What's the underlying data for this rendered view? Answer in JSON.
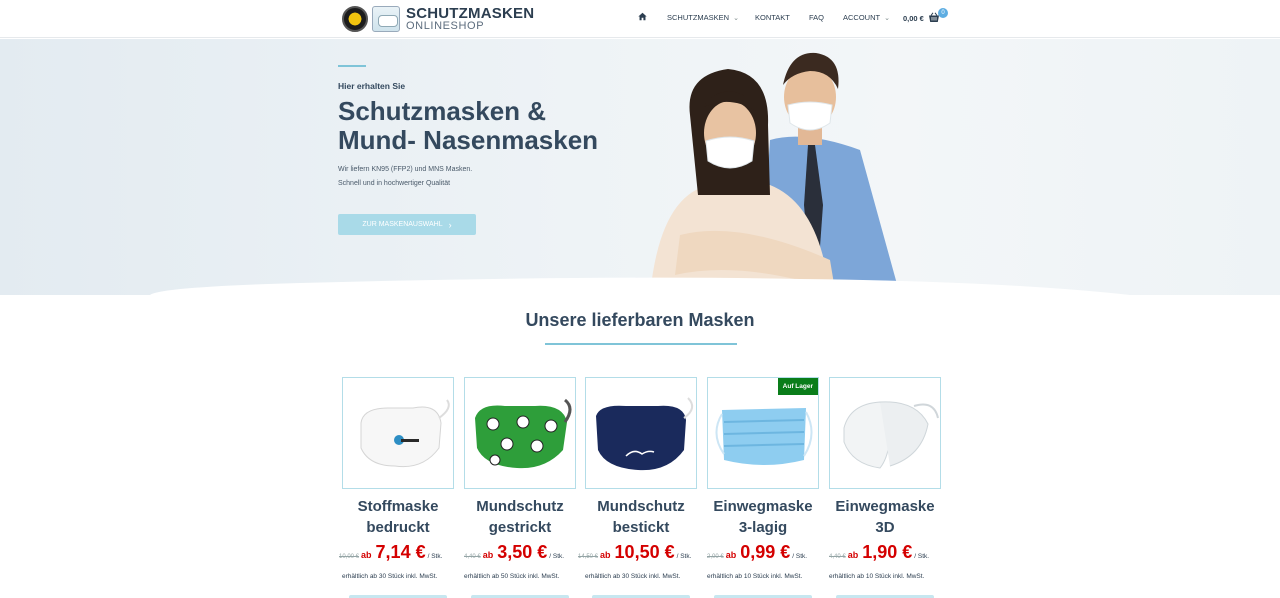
{
  "header": {
    "logo_title": "SCHUTZMASKEN",
    "logo_subtitle": "ONLINESHOP",
    "nav": [
      {
        "label": "SCHUTZMASKEN",
        "caret": true
      },
      {
        "label": "KONTAKT",
        "caret": false
      },
      {
        "label": "FAQ",
        "caret": false
      },
      {
        "label": "ACCOUNT",
        "caret": true
      }
    ],
    "cart_total": "0,00 €",
    "cart_count": "0"
  },
  "hero": {
    "kicker": "Hier erhalten Sie",
    "title_line1": "Schutzmasken &",
    "title_line2": "Mund- Nasenmasken",
    "sub_line1": "Wir liefern KN95 (FFP2) und MNS Masken.",
    "sub_line2": "Schnell und in hochwertiger Qualität",
    "button": "ZUR MASKENAUSWAHL"
  },
  "section": {
    "title": "Unsere lieferbaren Masken"
  },
  "products": [
    {
      "name_line1": "Stoffmaske",
      "name_line2": "bedruckt",
      "old": "10,00 €",
      "ab": "ab",
      "price": "7,14 €",
      "unit": "/ Stk.",
      "note": "erhältlich ab 30 Stück inkl. MwSt.",
      "badge": "",
      "icon": "printed-mask-image",
      "color": "#ffffff"
    },
    {
      "name_line1": "Mundschutz",
      "name_line2": "gestrickt",
      "old": "4,40 €",
      "ab": "ab",
      "price": "3,50 €",
      "unit": "/ Stk.",
      "note": "erhältlich ab 50 Stück inkl. MwSt.",
      "badge": "",
      "icon": "knitted-mask-image",
      "color": "#2e9e3a"
    },
    {
      "name_line1": "Mundschutz",
      "name_line2": "bestickt",
      "old": "14,50 €",
      "ab": "ab",
      "price": "10,50 €",
      "unit": "/ Stk.",
      "note": "erhältlich ab 30 Stück inkl. MwSt.",
      "badge": "",
      "icon": "embroidered-mask-image",
      "color": "#1a2a5c"
    },
    {
      "name_line1": "Einwegmaske",
      "name_line2": "3-lagig",
      "old": "2,00 €",
      "ab": "ab",
      "price": "0,99 €",
      "unit": "/ Stk.",
      "note": "erhältlich ab 10 Stück inkl. MwSt.",
      "badge": "Auf Lager",
      "icon": "disposable-mask-image",
      "color": "#8ecdf0"
    },
    {
      "name_line1": "Einwegmaske",
      "name_line2": "3D",
      "old": "4,40 €",
      "ab": "ab",
      "price": "1,90 €",
      "unit": "/ Stk.",
      "note": "erhältlich ab 10 Stück inkl. MwSt.",
      "badge": "",
      "icon": "kn95-mask-image",
      "color": "#f2f4f5"
    }
  ]
}
